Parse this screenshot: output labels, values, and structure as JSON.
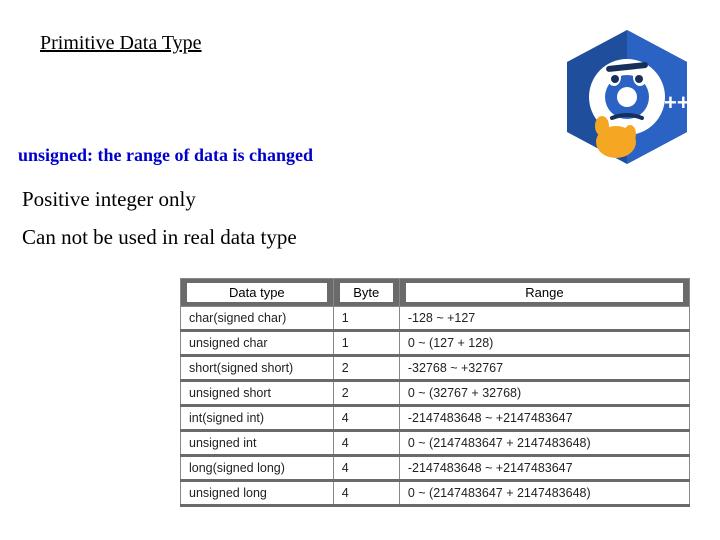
{
  "title": "Primitive Data Type",
  "subtitle": "unsigned: the range of data is changed",
  "notes": [
    "Positive integer only",
    "Can not be used in real data type"
  ],
  "logo": {
    "label": "C++ thinking logo",
    "plusplus": "++"
  },
  "table": {
    "headers": [
      "Data type",
      "Byte",
      "Range"
    ],
    "rows": [
      {
        "type": "char(signed char)",
        "byte": "1",
        "range": "-128 ~ +127"
      },
      {
        "type": "unsigned char",
        "byte": "1",
        "range": "0 ~ (127 + 128)"
      },
      {
        "type": "short(signed short)",
        "byte": "2",
        "range": "-32768 ~ +32767"
      },
      {
        "type": "unsigned short",
        "byte": "2",
        "range": "0 ~ (32767 + 32768)"
      },
      {
        "type": "int(signed int)",
        "byte": "4",
        "range": "-2147483648 ~ +2147483647"
      },
      {
        "type": "unsigned int",
        "byte": "4",
        "range": "0 ~ (2147483647 + 2147483648)"
      },
      {
        "type": "long(signed long)",
        "byte": "4",
        "range": "-2147483648 ~ +2147483647"
      },
      {
        "type": "unsigned long",
        "byte": "4",
        "range": "0 ~ (2147483647 + 2147483648)"
      }
    ]
  }
}
